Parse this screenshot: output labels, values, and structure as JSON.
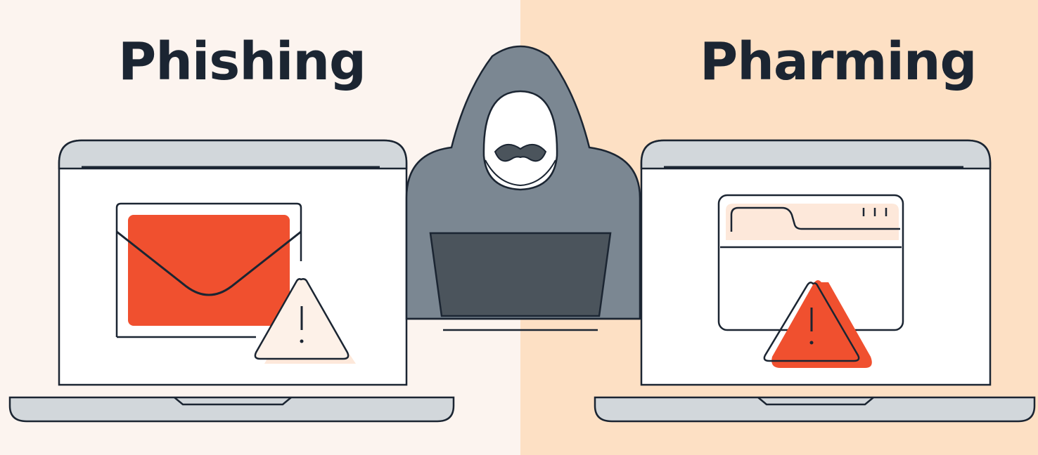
{
  "left_panel": {
    "title": "Phishing",
    "icons": [
      "laptop-icon",
      "envelope-icon",
      "warning-triangle-icon"
    ]
  },
  "center": {
    "icons": [
      "hooded-hacker-icon",
      "laptop-icon"
    ]
  },
  "right_panel": {
    "title": "Pharming",
    "icons": [
      "laptop-icon",
      "browser-window-icon",
      "warning-triangle-icon"
    ]
  },
  "colors": {
    "left_background": "#fcf4ef",
    "right_background": "#fde0c4",
    "outline": "#1b2532",
    "accent_red": "#f0502f",
    "hacker_gray": "#7b8792",
    "screen_dark": "#4b545c",
    "laptop_base": "#d2d7db"
  }
}
